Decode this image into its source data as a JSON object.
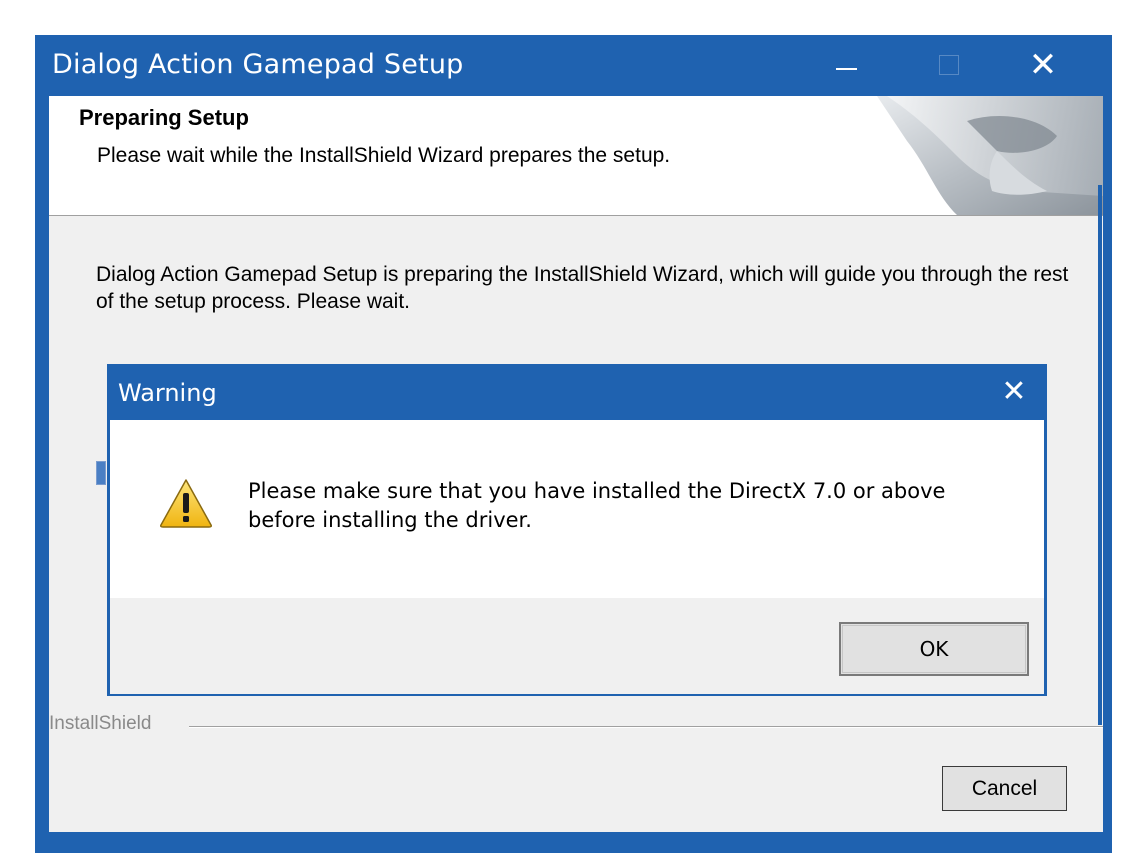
{
  "main_window": {
    "title": "Dialog Action Gamepad Setup",
    "header_title": "Preparing Setup",
    "header_subtitle": "Please wait while the InstallShield Wizard prepares the setup.",
    "body_text": "Dialog Action Gamepad Setup is preparing the InstallShield Wizard, which will guide you through the rest of the setup process. Please wait.",
    "separator_label": "InstallShield",
    "cancel_label": "Cancel",
    "controls": {
      "minimize": "minimize",
      "maximize": "maximize",
      "close": "✕"
    }
  },
  "warning_dialog": {
    "title": "Warning",
    "close_glyph": "✕",
    "message": "Please make sure that you have installed the DirectX 7.0 or above before installing the driver.",
    "ok_label": "OK",
    "icon": "warning-icon"
  },
  "colors": {
    "titlebar": "#1f62b0",
    "client_bg": "#f0f0f0",
    "button_bg": "#e1e1e1",
    "warning_yellow": "#f5c518"
  }
}
